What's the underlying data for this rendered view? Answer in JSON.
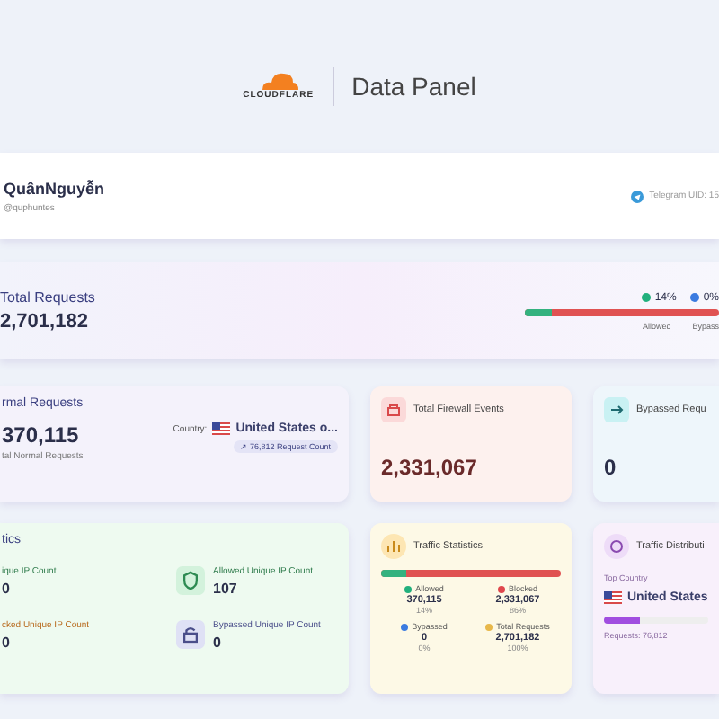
{
  "header": {
    "logo_text": "CLOUDFLARE",
    "title": "Data Panel"
  },
  "profile": {
    "name": "QuânNguyễn",
    "handle": "@quphuntes",
    "telegram": "Telegram UID: 15"
  },
  "total": {
    "label": "Total Requests",
    "value": "2,701,182",
    "legend": [
      {
        "value": "14%",
        "color": "#22b07d"
      },
      {
        "value": "0%",
        "color": "#3b7be0"
      }
    ],
    "level": 0.14,
    "bar_labels": [
      "Allowed",
      "Bypass"
    ]
  },
  "normal": {
    "title": "rmal Requests",
    "value": "370,115",
    "caption": "tal Normal Requests",
    "country_label": "Country:",
    "country": "United States o...",
    "badge": "↗ 76,812 Request Count"
  },
  "firewall": {
    "title": "Total Firewall Events",
    "value": "2,331,067"
  },
  "bypassed": {
    "title": "Bypassed Requ",
    "value": "0"
  },
  "ip_stats": {
    "title": "tics",
    "items": [
      {
        "label": "ique IP Count",
        "value": "0",
        "kind": "total"
      },
      {
        "label": "Allowed Unique IP Count",
        "value": "107",
        "kind": "allowed"
      },
      {
        "label": "cked Unique IP Count",
        "value": "0",
        "kind": "blocked"
      },
      {
        "label": "Bypassed Unique IP Count",
        "value": "0",
        "kind": "bypassed"
      }
    ]
  },
  "traffic": {
    "title": "Traffic Statistics",
    "level": 0.14,
    "items": [
      {
        "label": "Allowed",
        "value": "370,115",
        "pct": "14%",
        "color": "#22b07d"
      },
      {
        "label": "Blocked",
        "value": "2,331,067",
        "pct": "86%",
        "color": "#e0474c"
      },
      {
        "label": "Bypassed",
        "value": "0",
        "pct": "0%",
        "color": "#3b7be0"
      },
      {
        "label": "Total Requests",
        "value": "2,701,182",
        "pct": "100%",
        "color": "#e8b84a"
      }
    ]
  },
  "distribution": {
    "title": "Traffic Distributi",
    "top_label": "Top Country",
    "country": "United States",
    "level": 0.35,
    "requests": "Requests: 76,812"
  }
}
